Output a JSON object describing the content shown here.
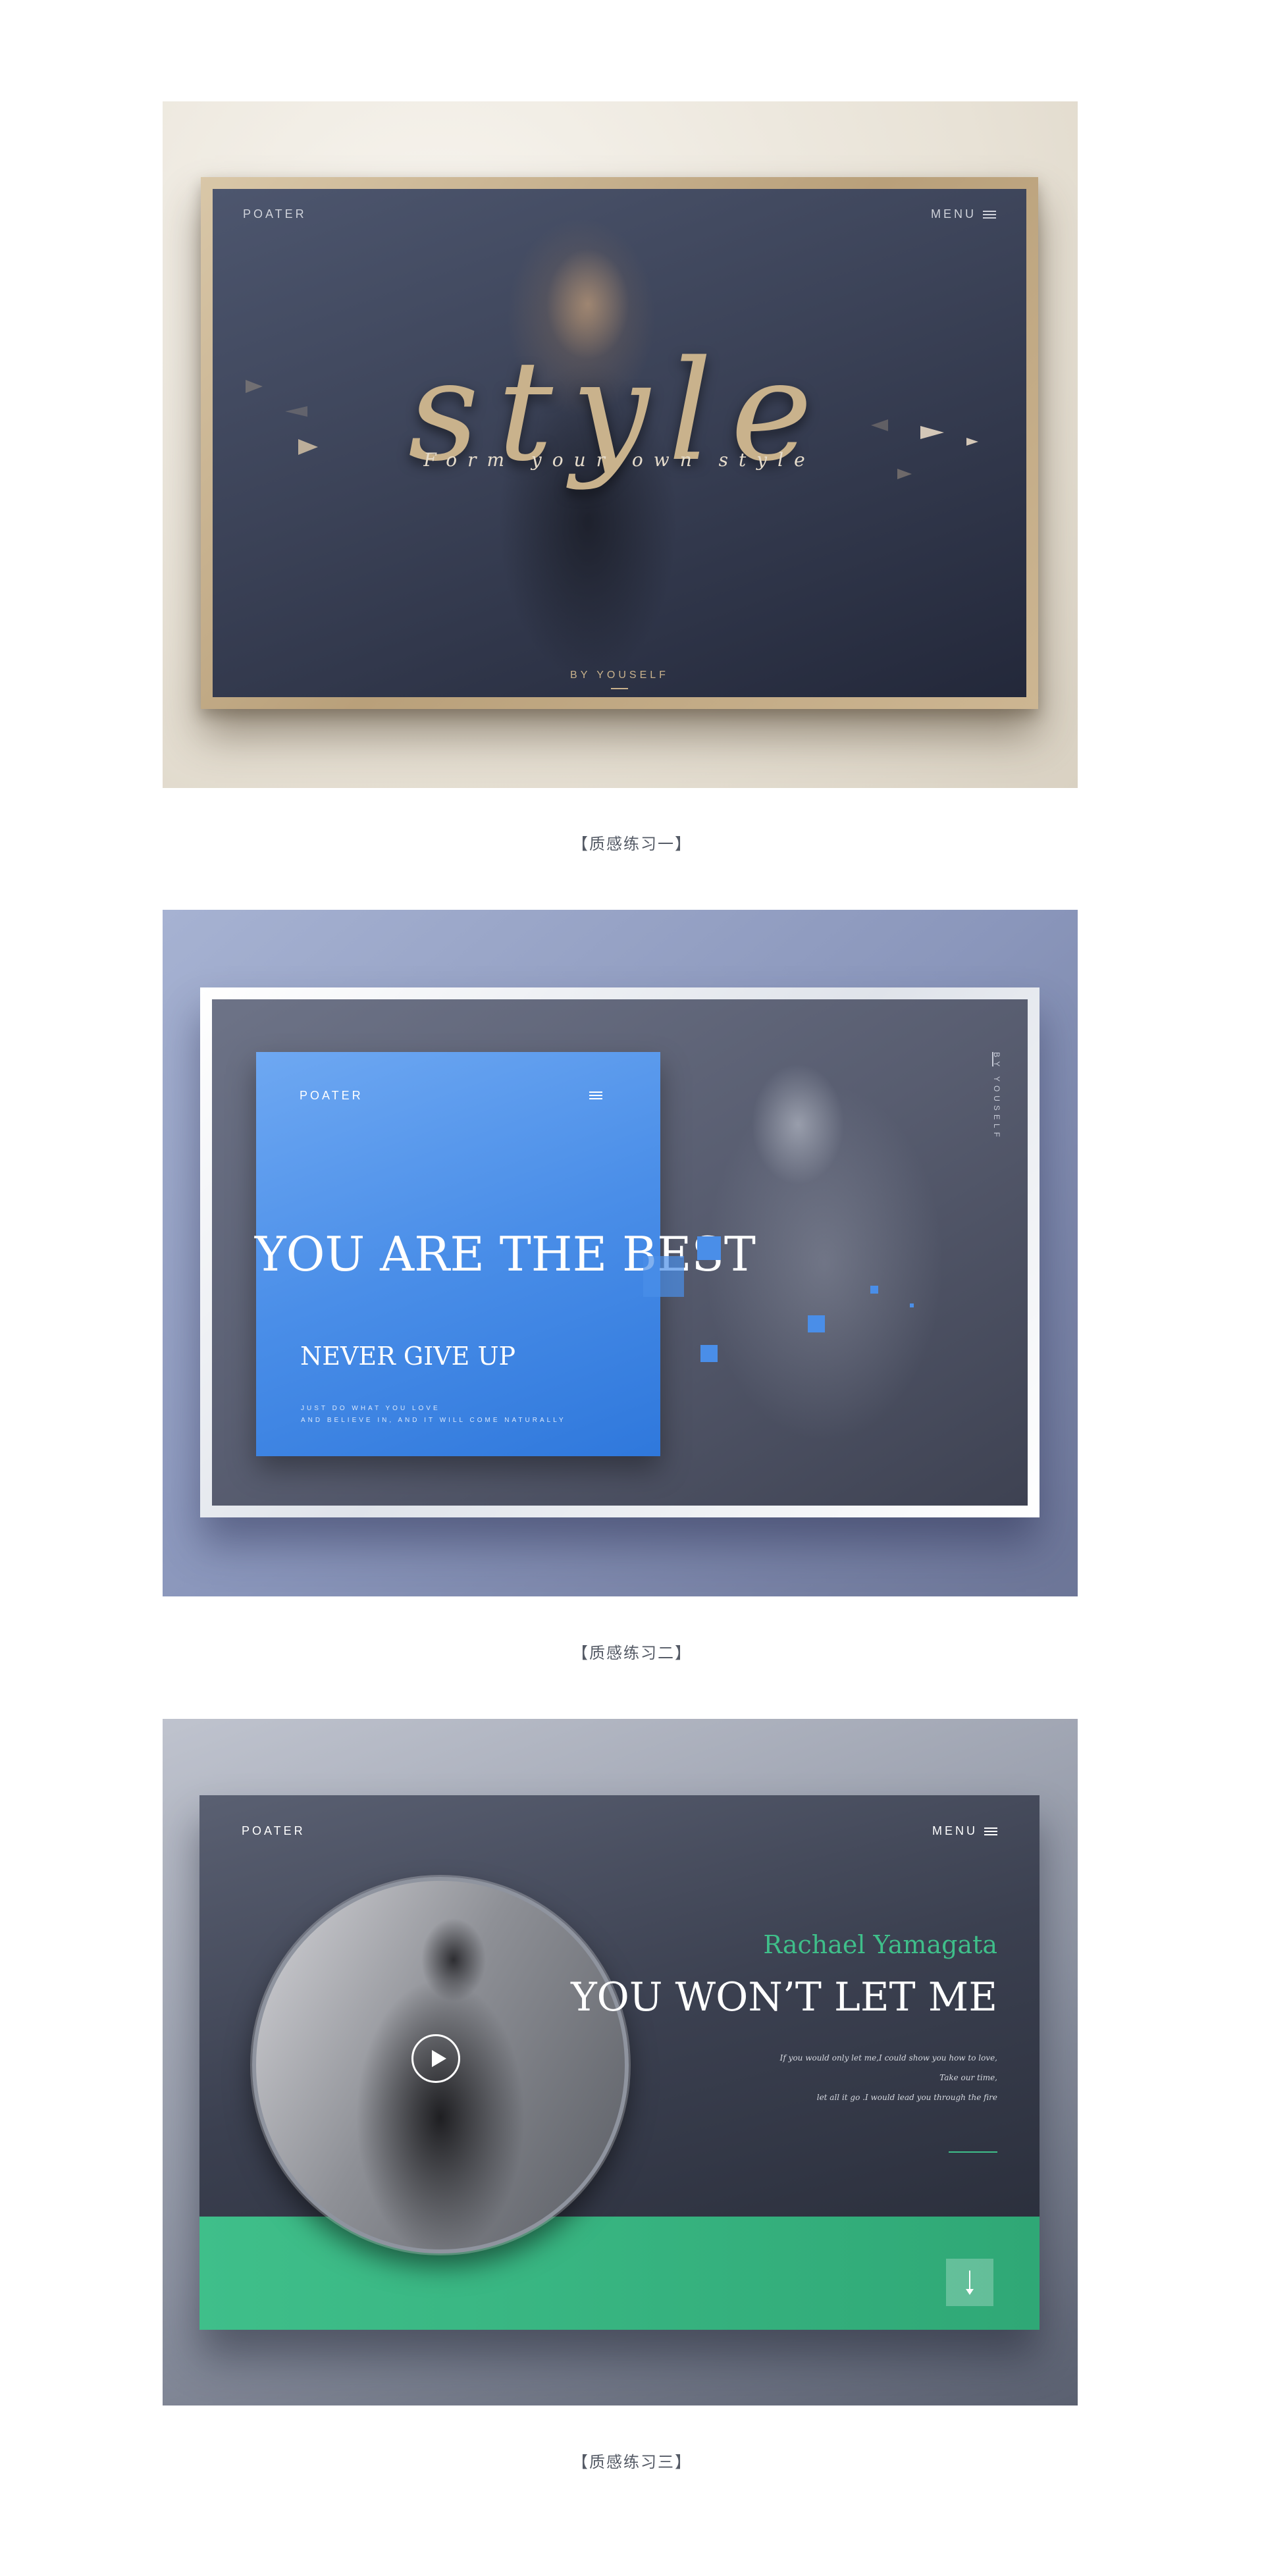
{
  "panel1": {
    "logo": "POATER",
    "menu_label": "MENU",
    "title": "style",
    "tagline": "Form your own style",
    "byline": "BY YOUSELF",
    "colors": {
      "gold": "#c9b28c",
      "screen": "#3b4257"
    },
    "icons": [
      "hamburger-icon"
    ]
  },
  "caption1": "【质感练习一】",
  "panel2": {
    "logo": "POATER",
    "vertical_text": "BY YOUSELF",
    "headline": "YOU ARE THE BEST",
    "subheadline": "NEVER GIVE UP",
    "small_line1": "JUST DO WHAT YOU LOVE",
    "small_line2": "AND BELIEVE IN, AND IT WILL COME NATURALLY",
    "colors": {
      "blue": "#4a8ee8"
    },
    "icons": [
      "hamburger-icon"
    ]
  },
  "caption2": "【质感练习二】",
  "panel3": {
    "logo": "POATER",
    "menu_label": "MENU",
    "artist": "Rachael Yamagata",
    "song": "YOU WON’T LET ME",
    "lyric1": "If you would only let me,I could show you how to love,",
    "lyric2": "Take our time,",
    "lyric3": "let all it go .I would lead you through the fire",
    "colors": {
      "green": "#3fbf8a"
    },
    "icons": [
      "hamburger-icon",
      "play-icon",
      "arrow-down-icon"
    ]
  },
  "caption3": "【质感练习三】"
}
